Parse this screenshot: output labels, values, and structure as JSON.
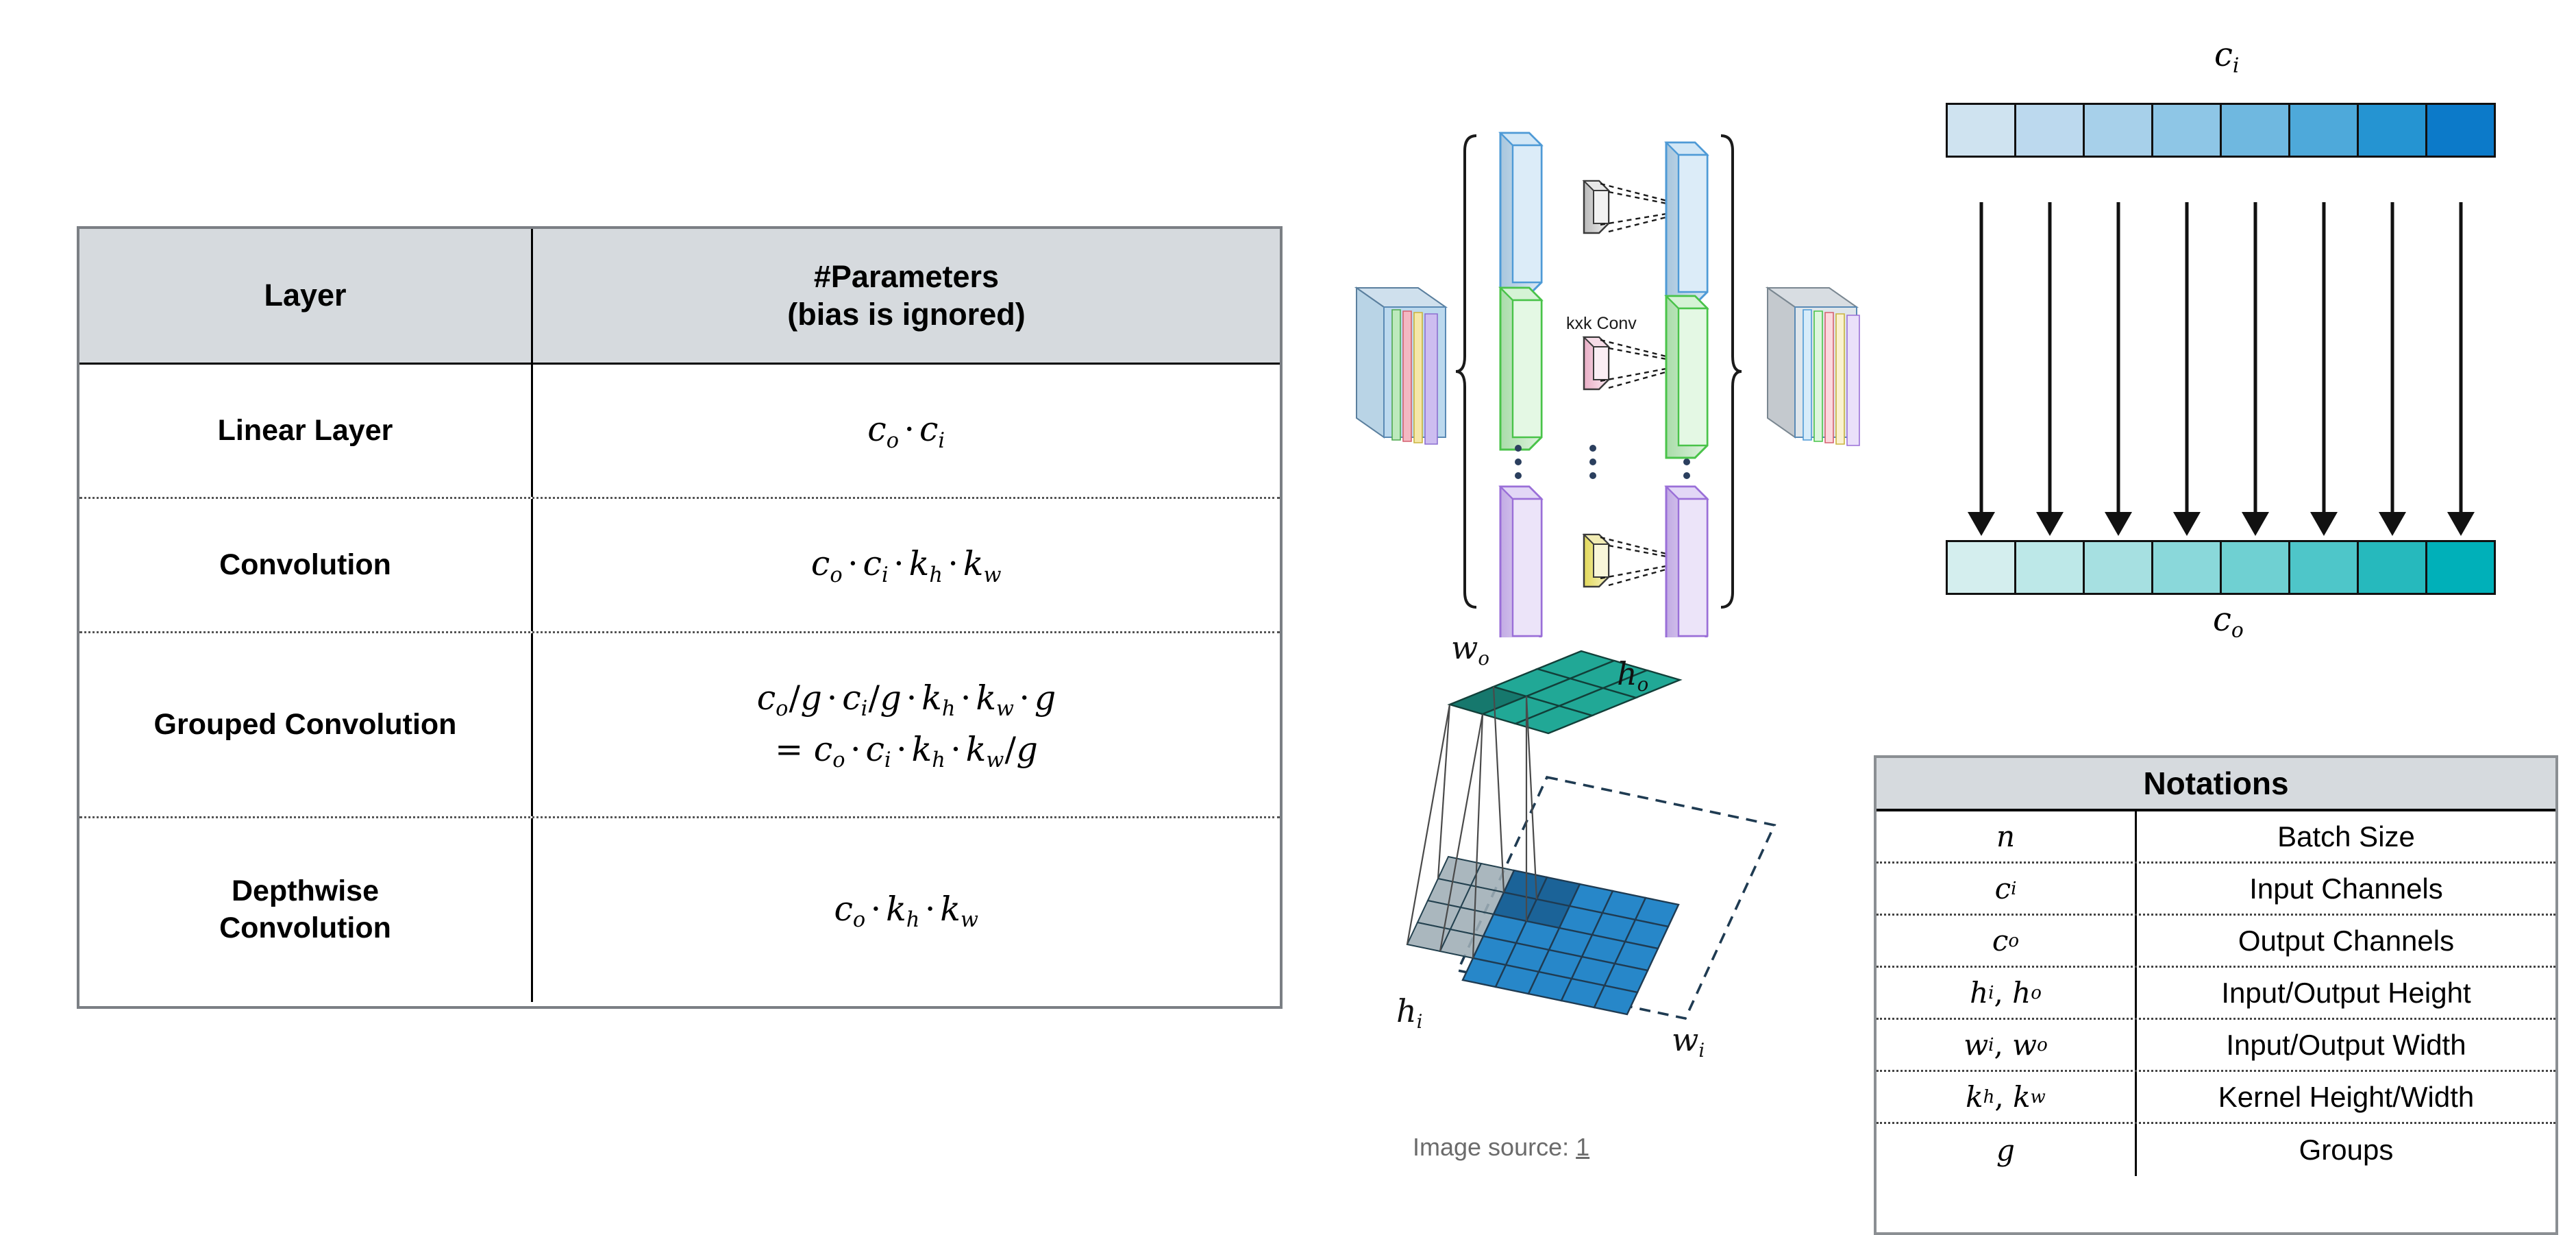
{
  "param_table": {
    "header": {
      "col1": "Layer",
      "col2_line1": "#Parameters",
      "col2_line2": "(bias is ignored)"
    },
    "rows": [
      {
        "layer": "Linear Layer",
        "formula_plain": "c_o · c_i",
        "formula_parts": [
          {
            "t": "c",
            "sub": "o"
          },
          {
            "t": "·"
          },
          {
            "t": "c",
            "sub": "i"
          }
        ]
      },
      {
        "layer": "Convolution",
        "formula_plain": "c_o · c_i · k_h · k_w",
        "formula_parts": [
          {
            "t": "c",
            "sub": "o"
          },
          {
            "t": "·"
          },
          {
            "t": "c",
            "sub": "i"
          },
          {
            "t": "·"
          },
          {
            "t": "k",
            "sub": "h"
          },
          {
            "t": "·"
          },
          {
            "t": "k",
            "sub": "w"
          }
        ]
      },
      {
        "layer": "Grouped Convolution",
        "formula_plain": "c_o/g · c_i/g · k_h · k_w · g",
        "formula_line2_plain": "= c_o · c_i · k_h · k_w/g"
      },
      {
        "layer_line1": "Depthwise",
        "layer_line2": "Convolution",
        "layer": "Depthwise Convolution",
        "formula_plain": "c_o · k_h · k_w"
      }
    ]
  },
  "notations_table": {
    "title": "Notations",
    "rows": [
      {
        "symbol_plain": "n",
        "description": "Batch Size"
      },
      {
        "symbol_plain": "c_i",
        "description": "Input Channels"
      },
      {
        "symbol_plain": "c_o",
        "description": "Output Channels"
      },
      {
        "symbol_plain": "h_i, h_o",
        "description": "Input/Output Height"
      },
      {
        "symbol_plain": "w_i, w_o",
        "description": "Input/Output Width"
      },
      {
        "symbol_plain": "k_h, k_w",
        "description": "Kernel Height/Width"
      },
      {
        "symbol_plain": "g",
        "description": "Groups"
      }
    ]
  },
  "channel_diagram": {
    "input_label_plain": "c_i",
    "output_label_plain": "c_o",
    "num_channels": 8,
    "input_colors": [
      "#cfe3f0",
      "#bcd9ee",
      "#a7d0ea",
      "#8ec6e6",
      "#6fb8e0",
      "#4ea9da",
      "#2594d2",
      "#0c7ac9"
    ],
    "output_colors": [
      "#d4eeee",
      "#bde8e8",
      "#a6e0e1",
      "#8ad8da",
      "#6fd0d2",
      "#4ec6c9",
      "#26b9bd",
      "#00b0b9"
    ],
    "num_arrows": 8
  },
  "conv_diagram": {
    "kernel_label": "kxk Conv",
    "plane_colors": [
      "#9ec9e8",
      "#8ee08e",
      "#c6a9ee"
    ],
    "kernel_colors": [
      "#c9c9c9",
      "#eeb6cd",
      "#ece46a"
    ],
    "stack_stripe_colors": [
      "#bcd9ee",
      "#bdeabd",
      "#f4b8c2",
      "#f5e7a8",
      "#cdbdf0"
    ],
    "ellipsis_dots": 3
  },
  "featmap_diagram": {
    "output_label_w_plain": "w_o",
    "output_label_h_plain": "h_o",
    "input_label_h_plain": "h_i",
    "input_label_w_plain": "w_i",
    "output_grid": "3x3",
    "input_grid": "5x5",
    "output_color": "#21a896",
    "output_highlight_color": "#16786d",
    "input_color": "#2787c9",
    "input_highlight_color": "#1b6398",
    "padding_color": "#9eadb5"
  },
  "caption": {
    "prefix": "Image source: ",
    "link": "1"
  },
  "colors": {
    "header_bg": "#d6dade",
    "table_border": "#7b7f84",
    "divider": "#000000",
    "caption_text": "#6b6b6b"
  }
}
